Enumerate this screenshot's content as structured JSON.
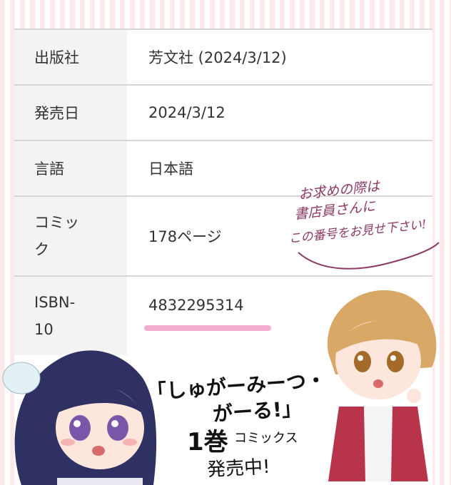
{
  "table": {
    "rows": [
      {
        "label": "出版社",
        "value": "芳文社 (2024/3/12)"
      },
      {
        "label": "発売日",
        "value": "2024/3/12"
      },
      {
        "label": "言語",
        "value": "日本語"
      },
      {
        "label": "コミック",
        "value": "178ページ"
      },
      {
        "label": "ISBN-10",
        "value": "4832295314"
      }
    ]
  },
  "handwritten_note": {
    "line1": "お求めの際は",
    "line2": "書店員さんに",
    "line3": "この番号をお見せ下さい!"
  },
  "promo": {
    "title_line1": "「しゅがーみーつ・",
    "title_line2": "がーる!」",
    "volume": "1巻",
    "type": "コミックス",
    "status": "発売中!"
  },
  "colors": {
    "stripe": "#fbe9ec",
    "underline": "#f3a6cb",
    "note_ink": "#8c3966"
  }
}
